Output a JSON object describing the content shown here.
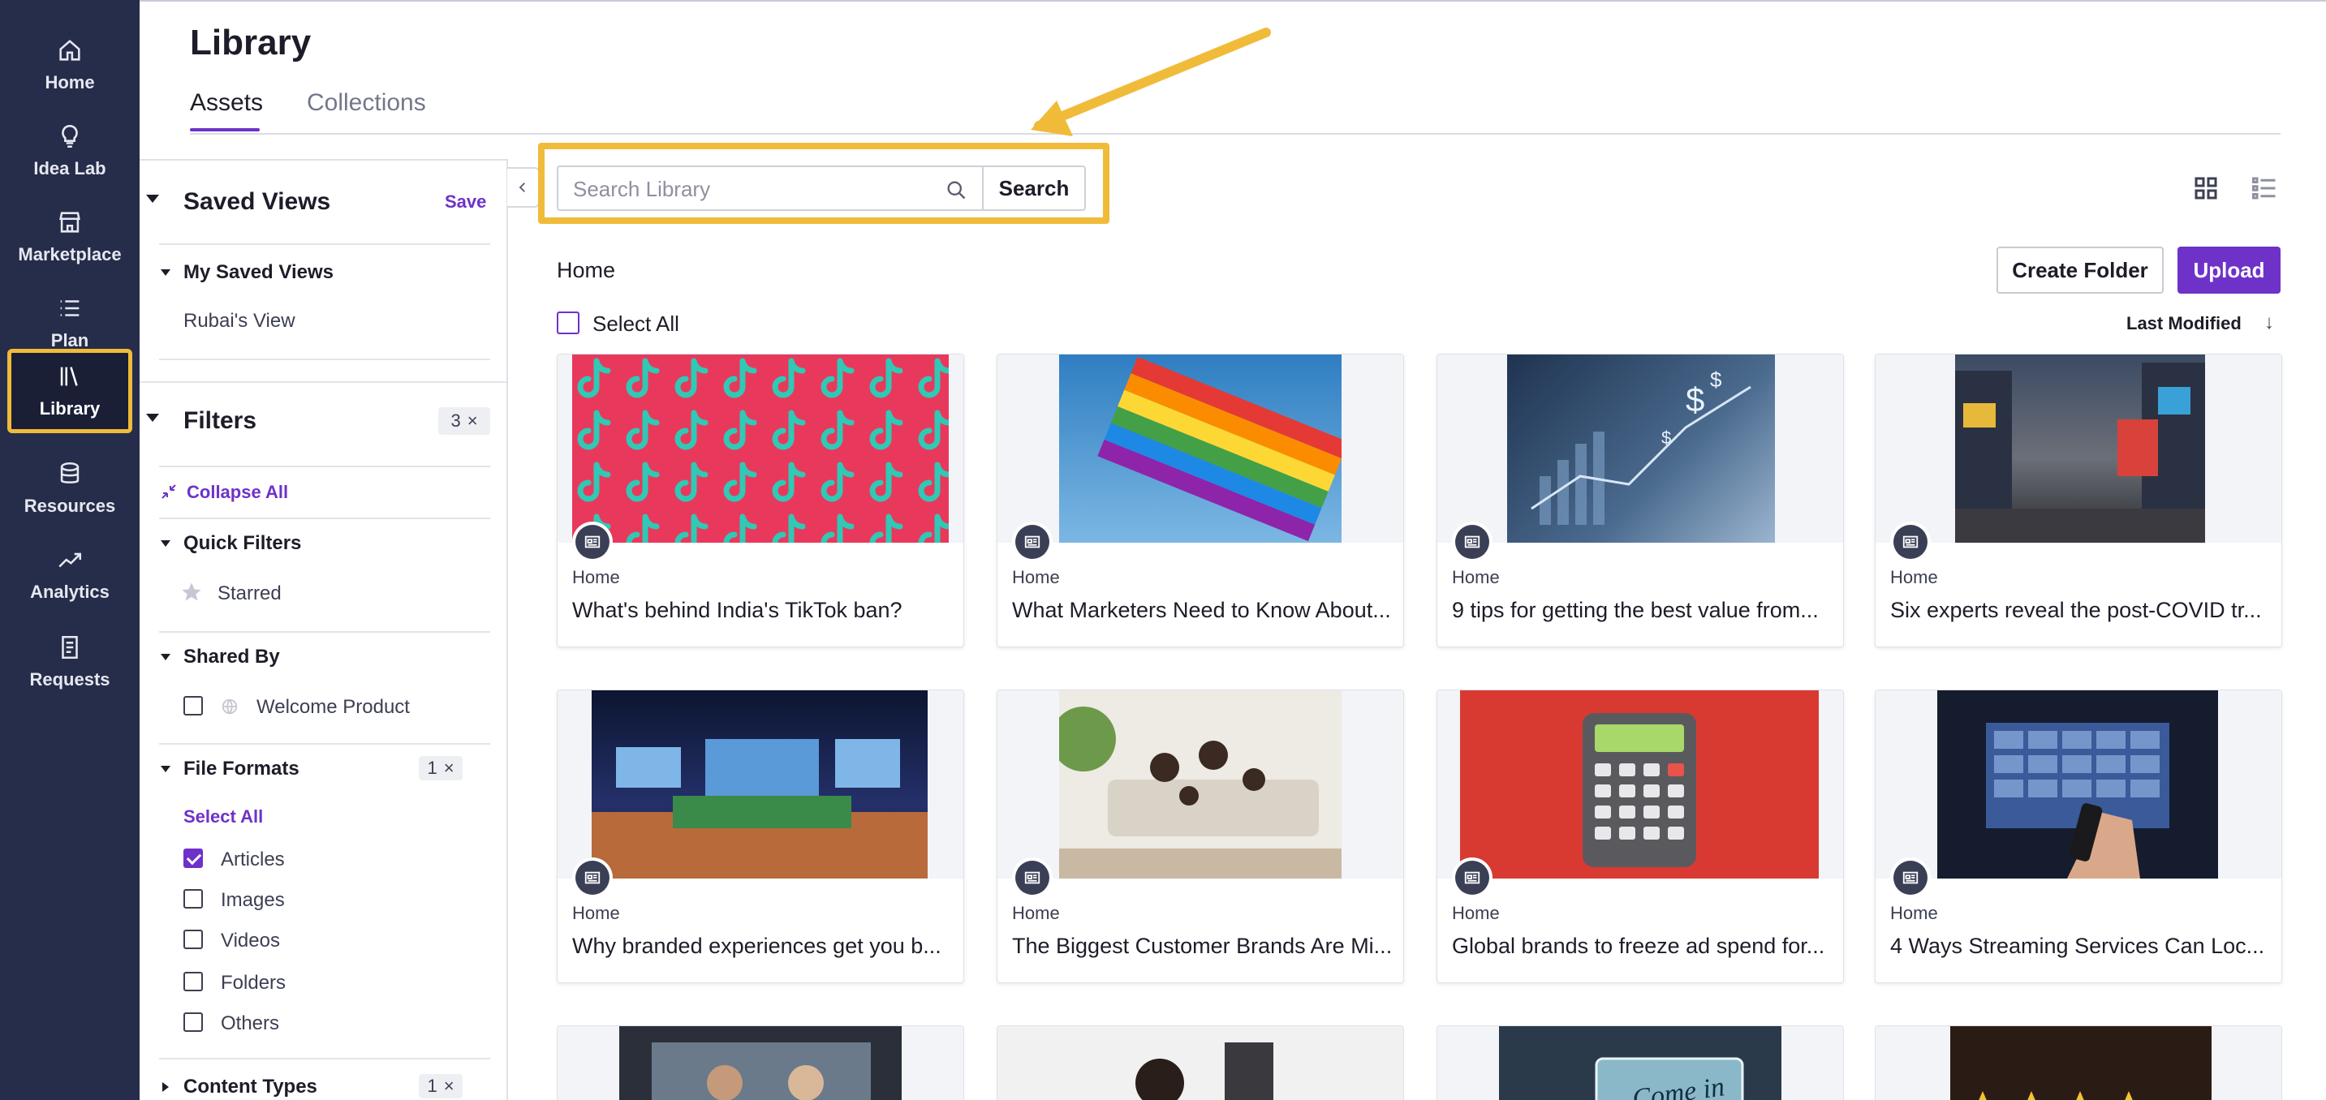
{
  "nav": {
    "items": [
      {
        "label": "Home",
        "icon": "home-icon"
      },
      {
        "label": "Idea Lab",
        "icon": "lightbulb-icon"
      },
      {
        "label": "Marketplace",
        "icon": "storefront-icon"
      },
      {
        "label": "Plan",
        "icon": "list-icon"
      },
      {
        "label": "Library",
        "icon": "library-icon",
        "active": true
      },
      {
        "label": "Resources",
        "icon": "database-icon"
      },
      {
        "label": "Analytics",
        "icon": "trend-icon"
      },
      {
        "label": "Requests",
        "icon": "document-icon"
      }
    ]
  },
  "header": {
    "title": "Library",
    "tabs": [
      {
        "label": "Assets",
        "active": true
      },
      {
        "label": "Collections",
        "active": false
      }
    ]
  },
  "sidebar": {
    "saved_views": {
      "title": "Saved Views",
      "save_label": "Save",
      "group_title": "My Saved Views",
      "items": [
        "Rubai's View"
      ]
    },
    "filters": {
      "title": "Filters",
      "count": "3",
      "collapse_all": "Collapse All",
      "quick_filters": {
        "title": "Quick Filters",
        "items": [
          "Starred"
        ]
      },
      "shared_by": {
        "title": "Shared By",
        "items": [
          "Welcome Product"
        ]
      },
      "file_formats": {
        "title": "File Formats",
        "count": "1",
        "select_all": "Select All",
        "options": [
          {
            "label": "Articles",
            "checked": true
          },
          {
            "label": "Images",
            "checked": false
          },
          {
            "label": "Videos",
            "checked": false
          },
          {
            "label": "Folders",
            "checked": false
          },
          {
            "label": "Others",
            "checked": false
          }
        ]
      },
      "content_types": {
        "title": "Content Types",
        "count": "1"
      }
    }
  },
  "search": {
    "placeholder": "Search Library",
    "value": "",
    "button_label": "Search"
  },
  "main": {
    "breadcrumb": "Home",
    "create_folder_label": "Create Folder",
    "upload_label": "Upload",
    "select_all_label": "Select All",
    "sort_label": "Last Modified",
    "sort_direction_icon": "↓"
  },
  "cards": [
    {
      "folder": "Home",
      "title": "What's behind India's TikTok ban?"
    },
    {
      "folder": "Home",
      "title": "What Marketers Need to Know About..."
    },
    {
      "folder": "Home",
      "title": "9 tips for getting the best value from..."
    },
    {
      "folder": "Home",
      "title": "Six experts reveal the post-COVID tr..."
    },
    {
      "folder": "Home",
      "title": "Why branded experiences get you b..."
    },
    {
      "folder": "Home",
      "title": "The Biggest Customer Brands Are Mi..."
    },
    {
      "folder": "Home",
      "title": "Global brands to freeze ad spend for..."
    },
    {
      "folder": "Home",
      "title": "4 Ways Streaming Services Can Loc..."
    }
  ],
  "partial_card_text": "Come in",
  "colors": {
    "accent": "#6e32c9",
    "nav_bg": "#262d4a",
    "highlight": "#f1bb3a"
  }
}
